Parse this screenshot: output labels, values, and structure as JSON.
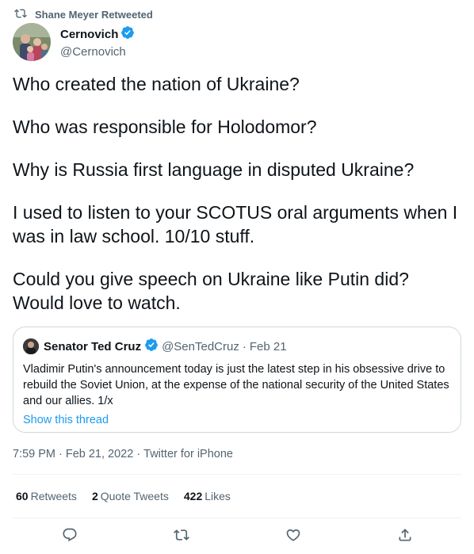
{
  "retweet_context": {
    "text": "Shane Meyer Retweeted",
    "icon": "retweet-icon"
  },
  "author": {
    "name": "Cernovich",
    "handle": "@Cernovich",
    "verified": true
  },
  "tweet": {
    "paragraphs": [
      "Who created the nation of Ukraine?",
      "Who was responsible for Holodomor?",
      "Why is Russia first language in disputed Ukraine?",
      "I used to listen to your SCOTUS oral arguments when I was in law school. 10/10 stuff.",
      "Could you give speech on Ukraine like Putin did? Would love to watch."
    ]
  },
  "quoted_tweet": {
    "name": "Senator Ted Cruz",
    "handle": "@SenTedCruz",
    "separator": "·",
    "date": "Feb 21",
    "text": "Vladimir Putin's announcement today is just the latest step in his obsessive drive to rebuild the Soviet Union, at the expense of the national security of the United States and our allies. 1/x",
    "link": "Show this thread"
  },
  "meta": {
    "time": "7:59 PM",
    "separator": "·",
    "date": "Feb 21, 2022",
    "source": "Twitter for iPhone"
  },
  "stats": {
    "retweets_count": "60",
    "retweets_label": "Retweets",
    "quotes_count": "2",
    "quotes_label": "Quote Tweets",
    "likes_count": "422",
    "likes_label": "Likes"
  },
  "actions": [
    "reply-icon",
    "retweet-icon",
    "like-icon",
    "share-icon"
  ],
  "colors": {
    "text": "#0f1419",
    "secondary": "#536471",
    "accent": "#1d9bf0",
    "border": "#cfd9de"
  }
}
